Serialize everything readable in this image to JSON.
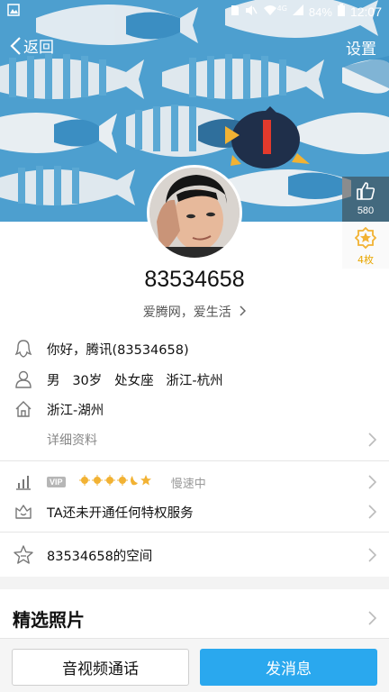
{
  "statusbar": {
    "signal_label": "4G",
    "battery": "84%",
    "time": "12:07"
  },
  "nav": {
    "back_label": "返回",
    "settings_label": "设置"
  },
  "profile": {
    "like_count": "580",
    "badge_count": "4枚",
    "qq_number": "83534658",
    "signature": "爱腾网，爱生活"
  },
  "info": {
    "qq_line": "你好，腾讯(83534658)",
    "basic_line": "男   30岁   处女座   浙江-杭州",
    "hometown": "浙江-湖州",
    "details_label": "详细资料"
  },
  "vip": {
    "tag": "VIP",
    "speed_label": "慢速中",
    "privilege_text": "TA还未开通任何特权服务"
  },
  "space": {
    "label": "83534658的空间"
  },
  "photos": {
    "title": "精选照片"
  },
  "actions": {
    "call_label": "音视频通话",
    "message_label": "发消息"
  },
  "colors": {
    "accent": "#2aa8ee",
    "cover_bg": "#4d9fcf",
    "level_sun": "#f2b233"
  }
}
